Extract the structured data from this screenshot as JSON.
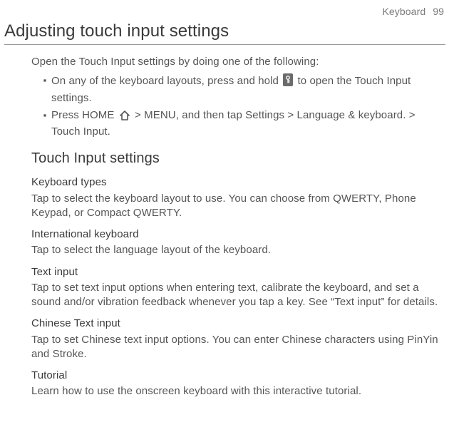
{
  "header": {
    "section": "Keyboard",
    "page_number": "99"
  },
  "title": "Adjusting touch input settings",
  "intro": "Open the Touch Input settings by doing one of the following:",
  "bullets": [
    {
      "pre": "On any of the keyboard layouts, press and hold ",
      "post": " to open the Touch Input settings."
    },
    {
      "pre": "Press HOME ",
      "post": " > MENU, and then tap Settings > Language & keyboard. > Touch Input."
    }
  ],
  "section_heading": "Touch Input settings",
  "settings": [
    {
      "name": "Keyboard types",
      "desc": "Tap to select the keyboard layout to use. You can choose from QWERTY, Phone Keypad, or Compact QWERTY."
    },
    {
      "name": "International keyboard",
      "desc": "Tap to select the language layout of the keyboard."
    },
    {
      "name": "Text input",
      "desc": "Tap to set text input options when entering text, calibrate the keyboard, and set a sound and/or vibration feedback whenever you tap a key. See “Text input” for details."
    },
    {
      "name": "Chinese Text input",
      "desc": "Tap to set Chinese text input options. You can enter Chinese characters using PinYin and Stroke."
    },
    {
      "name": "Tutorial",
      "desc": "Learn how to use the onscreen keyboard with this interactive tutorial."
    }
  ]
}
